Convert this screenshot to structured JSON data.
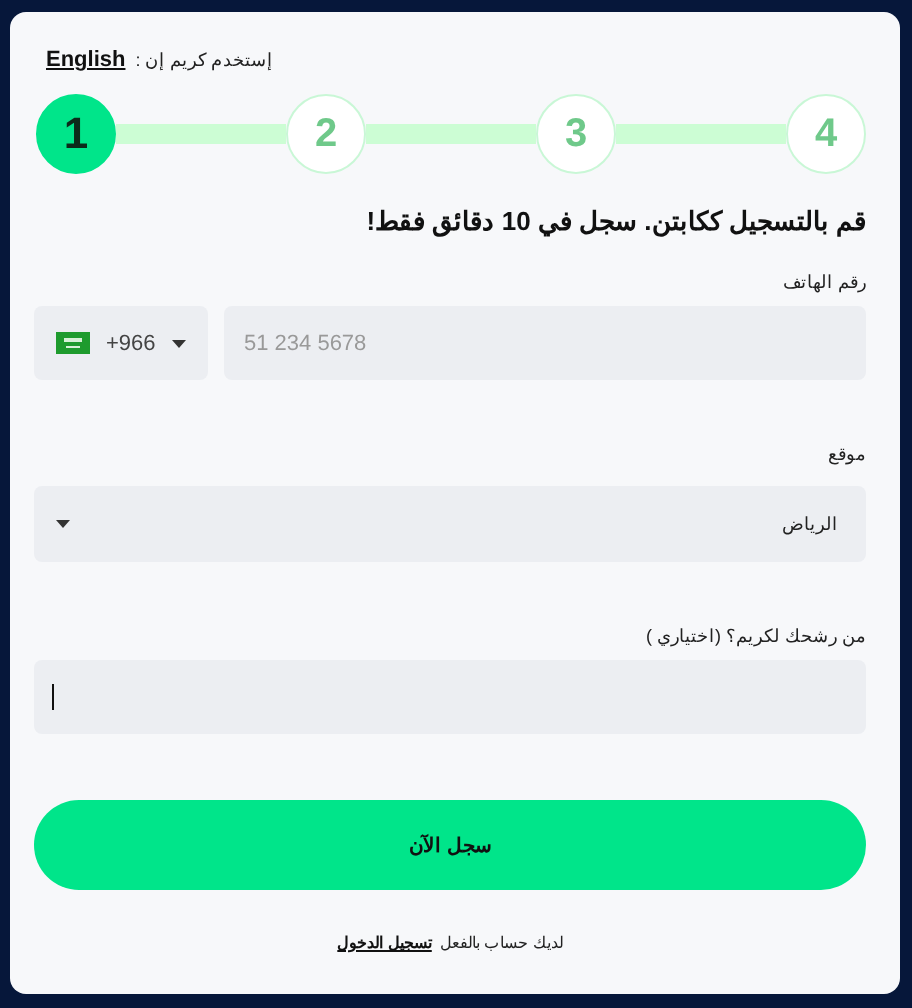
{
  "language": {
    "prompt": "إستخدم كريم إن :",
    "link": "English"
  },
  "steps": [
    {
      "label": "4",
      "selected": false
    },
    {
      "label": "3",
      "selected": false
    },
    {
      "label": "2",
      "selected": false
    },
    {
      "label": "1",
      "selected": true
    }
  ],
  "headline": "قم بالتسجيل ككابتن. سجل في 10 دقائق فقط!",
  "phone": {
    "label": "رقم الهاتف",
    "country_code": "+966",
    "placeholder": "51 234 5678"
  },
  "location": {
    "label": "موقع",
    "value": "الرياض"
  },
  "referral": {
    "label": "من رشحك لكريم؟ (اختياري )",
    "focused": true
  },
  "submit": "سجل الآن",
  "footer": {
    "text": "لديك حساب بالفعل",
    "link": "تسجيل الدخول"
  }
}
